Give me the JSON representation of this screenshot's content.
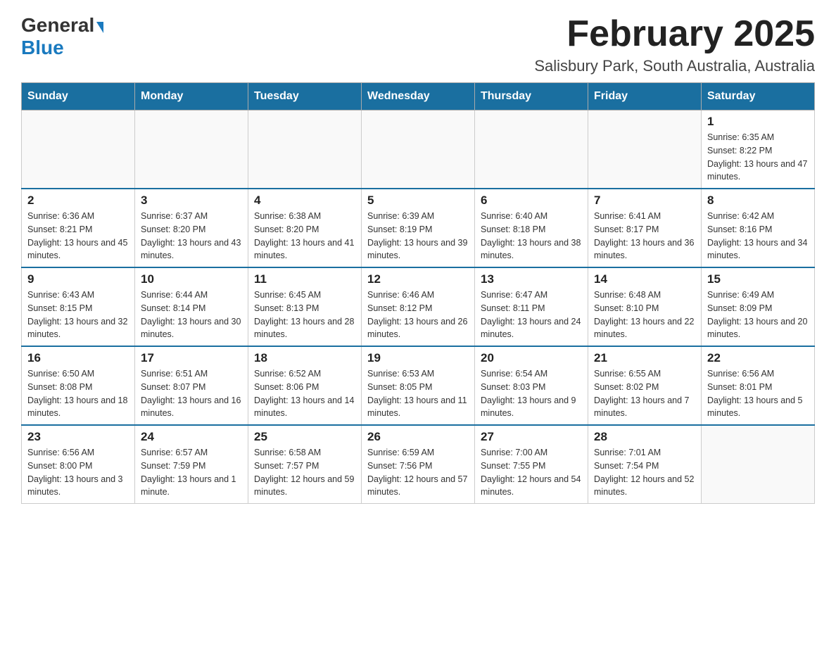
{
  "header": {
    "logo_general": "General",
    "logo_blue": "Blue",
    "month_title": "February 2025",
    "location": "Salisbury Park, South Australia, Australia"
  },
  "weekdays": [
    "Sunday",
    "Monday",
    "Tuesday",
    "Wednesday",
    "Thursday",
    "Friday",
    "Saturday"
  ],
  "weeks": [
    [
      {
        "day": "",
        "info": ""
      },
      {
        "day": "",
        "info": ""
      },
      {
        "day": "",
        "info": ""
      },
      {
        "day": "",
        "info": ""
      },
      {
        "day": "",
        "info": ""
      },
      {
        "day": "",
        "info": ""
      },
      {
        "day": "1",
        "info": "Sunrise: 6:35 AM\nSunset: 8:22 PM\nDaylight: 13 hours and 47 minutes."
      }
    ],
    [
      {
        "day": "2",
        "info": "Sunrise: 6:36 AM\nSunset: 8:21 PM\nDaylight: 13 hours and 45 minutes."
      },
      {
        "day": "3",
        "info": "Sunrise: 6:37 AM\nSunset: 8:20 PM\nDaylight: 13 hours and 43 minutes."
      },
      {
        "day": "4",
        "info": "Sunrise: 6:38 AM\nSunset: 8:20 PM\nDaylight: 13 hours and 41 minutes."
      },
      {
        "day": "5",
        "info": "Sunrise: 6:39 AM\nSunset: 8:19 PM\nDaylight: 13 hours and 39 minutes."
      },
      {
        "day": "6",
        "info": "Sunrise: 6:40 AM\nSunset: 8:18 PM\nDaylight: 13 hours and 38 minutes."
      },
      {
        "day": "7",
        "info": "Sunrise: 6:41 AM\nSunset: 8:17 PM\nDaylight: 13 hours and 36 minutes."
      },
      {
        "day": "8",
        "info": "Sunrise: 6:42 AM\nSunset: 8:16 PM\nDaylight: 13 hours and 34 minutes."
      }
    ],
    [
      {
        "day": "9",
        "info": "Sunrise: 6:43 AM\nSunset: 8:15 PM\nDaylight: 13 hours and 32 minutes."
      },
      {
        "day": "10",
        "info": "Sunrise: 6:44 AM\nSunset: 8:14 PM\nDaylight: 13 hours and 30 minutes."
      },
      {
        "day": "11",
        "info": "Sunrise: 6:45 AM\nSunset: 8:13 PM\nDaylight: 13 hours and 28 minutes."
      },
      {
        "day": "12",
        "info": "Sunrise: 6:46 AM\nSunset: 8:12 PM\nDaylight: 13 hours and 26 minutes."
      },
      {
        "day": "13",
        "info": "Sunrise: 6:47 AM\nSunset: 8:11 PM\nDaylight: 13 hours and 24 minutes."
      },
      {
        "day": "14",
        "info": "Sunrise: 6:48 AM\nSunset: 8:10 PM\nDaylight: 13 hours and 22 minutes."
      },
      {
        "day": "15",
        "info": "Sunrise: 6:49 AM\nSunset: 8:09 PM\nDaylight: 13 hours and 20 minutes."
      }
    ],
    [
      {
        "day": "16",
        "info": "Sunrise: 6:50 AM\nSunset: 8:08 PM\nDaylight: 13 hours and 18 minutes."
      },
      {
        "day": "17",
        "info": "Sunrise: 6:51 AM\nSunset: 8:07 PM\nDaylight: 13 hours and 16 minutes."
      },
      {
        "day": "18",
        "info": "Sunrise: 6:52 AM\nSunset: 8:06 PM\nDaylight: 13 hours and 14 minutes."
      },
      {
        "day": "19",
        "info": "Sunrise: 6:53 AM\nSunset: 8:05 PM\nDaylight: 13 hours and 11 minutes."
      },
      {
        "day": "20",
        "info": "Sunrise: 6:54 AM\nSunset: 8:03 PM\nDaylight: 13 hours and 9 minutes."
      },
      {
        "day": "21",
        "info": "Sunrise: 6:55 AM\nSunset: 8:02 PM\nDaylight: 13 hours and 7 minutes."
      },
      {
        "day": "22",
        "info": "Sunrise: 6:56 AM\nSunset: 8:01 PM\nDaylight: 13 hours and 5 minutes."
      }
    ],
    [
      {
        "day": "23",
        "info": "Sunrise: 6:56 AM\nSunset: 8:00 PM\nDaylight: 13 hours and 3 minutes."
      },
      {
        "day": "24",
        "info": "Sunrise: 6:57 AM\nSunset: 7:59 PM\nDaylight: 13 hours and 1 minute."
      },
      {
        "day": "25",
        "info": "Sunrise: 6:58 AM\nSunset: 7:57 PM\nDaylight: 12 hours and 59 minutes."
      },
      {
        "day": "26",
        "info": "Sunrise: 6:59 AM\nSunset: 7:56 PM\nDaylight: 12 hours and 57 minutes."
      },
      {
        "day": "27",
        "info": "Sunrise: 7:00 AM\nSunset: 7:55 PM\nDaylight: 12 hours and 54 minutes."
      },
      {
        "day": "28",
        "info": "Sunrise: 7:01 AM\nSunset: 7:54 PM\nDaylight: 12 hours and 52 minutes."
      },
      {
        "day": "",
        "info": ""
      }
    ]
  ]
}
